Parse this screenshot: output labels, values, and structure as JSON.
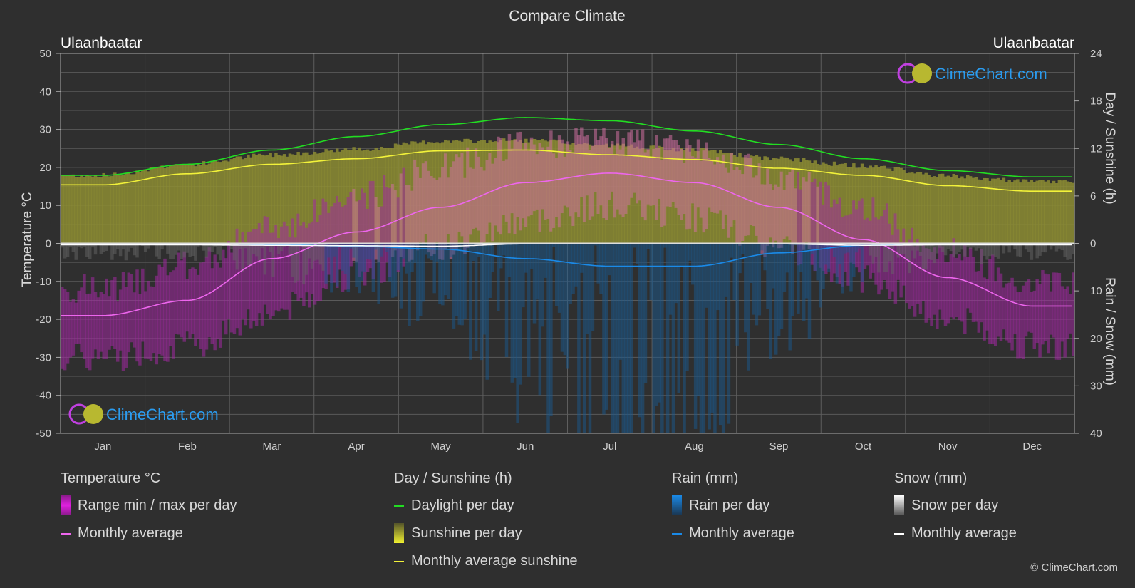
{
  "page_title": "Compare Climate",
  "location_left": "Ulaanbaatar",
  "location_right": "Ulaanbaatar",
  "watermark": "ClimeChart.com",
  "copyright": "© ClimeChart.com",
  "colors": {
    "background": "#2f2f2f",
    "daylight": "#22dd22",
    "sunshine_avg": "#f2f23a",
    "sunshine_fill": "#8c8c32",
    "temp_avg": "#ee66ee",
    "temp_range": "#b030b0",
    "rain": "#1a8ae8",
    "snow": "#ffffff",
    "watermark": "#2a9cf0"
  },
  "legend": {
    "groups": [
      {
        "title": "Temperature °C",
        "items": [
          {
            "label": "Range min / max per day",
            "kind": "bar",
            "color": "#e020e0"
          },
          {
            "label": "Monthly average",
            "kind": "line",
            "color": "#ee66ee"
          }
        ]
      },
      {
        "title": "Day / Sunshine (h)",
        "items": [
          {
            "label": "Daylight per day",
            "kind": "line",
            "color": "#22dd22"
          },
          {
            "label": "Sunshine per day",
            "kind": "bar",
            "color": "#e8e830"
          },
          {
            "label": "Monthly average sunshine",
            "kind": "line",
            "color": "#f2f23a"
          }
        ]
      },
      {
        "title": "Rain (mm)",
        "items": [
          {
            "label": "Rain per day",
            "kind": "bar",
            "color": "#1a8ae8"
          },
          {
            "label": "Monthly average",
            "kind": "line",
            "color": "#1a8ae8"
          }
        ]
      },
      {
        "title": "Snow (mm)",
        "items": [
          {
            "label": "Snow per day",
            "kind": "bar",
            "color": "#ffffff"
          },
          {
            "label": "Monthly average",
            "kind": "line",
            "color": "#ffffff"
          }
        ]
      }
    ]
  },
  "chart_data": {
    "type": "line",
    "title": "Compare Climate",
    "categories": [
      "Jan",
      "Feb",
      "Mar",
      "Apr",
      "May",
      "Jun",
      "Jul",
      "Aug",
      "Sep",
      "Oct",
      "Nov",
      "Dec"
    ],
    "y_left": {
      "label": "Temperature °C",
      "range": [
        -50,
        50
      ],
      "ticks": [
        50,
        40,
        30,
        20,
        10,
        0,
        -10,
        -20,
        -30,
        -40,
        -50
      ]
    },
    "y_right_top": {
      "label": "Day / Sunshine (h)",
      "range": [
        0,
        24
      ],
      "ticks": [
        24,
        18,
        12,
        6,
        0
      ]
    },
    "y_right_bottom": {
      "label": "Rain / Snow (mm)",
      "range": [
        0,
        40
      ],
      "ticks": [
        0,
        10,
        20,
        30,
        40
      ]
    },
    "grid": true,
    "series": [
      {
        "name": "Daylight per day (h)",
        "axis": "sunshine",
        "values": [
          8.6,
          10.0,
          11.8,
          13.5,
          15.0,
          15.9,
          15.5,
          14.2,
          12.5,
          10.7,
          9.2,
          8.4
        ]
      },
      {
        "name": "Monthly average sunshine (h)",
        "axis": "sunshine",
        "values": [
          7.4,
          8.8,
          10.0,
          10.7,
          11.7,
          11.8,
          11.2,
          10.6,
          9.5,
          8.6,
          7.3,
          6.6
        ]
      },
      {
        "name": "Monthly average temperature (°C)",
        "axis": "temperature",
        "values": [
          -19.0,
          -15.0,
          -4.0,
          3.0,
          9.5,
          16.0,
          18.5,
          16.0,
          9.5,
          1.0,
          -9.0,
          -16.5
        ]
      },
      {
        "name": "Rain monthly average (mm)",
        "axis": "precip",
        "values": [
          0.0,
          0.0,
          0.2,
          0.6,
          1.2,
          3.2,
          4.8,
          4.8,
          2.0,
          0.4,
          0.1,
          0.0
        ]
      },
      {
        "name": "Snow monthly average (mm)",
        "axis": "precip",
        "values": [
          0.3,
          0.3,
          0.4,
          0.5,
          0.6,
          0.1,
          0.0,
          0.0,
          0.1,
          0.4,
          0.3,
          0.3
        ]
      },
      {
        "name": "Temperature daily max envelope (°C)",
        "axis": "temperature",
        "values": [
          -12,
          -6,
          4,
          12,
          20,
          26,
          27,
          25,
          18,
          9,
          -2,
          -10
        ]
      },
      {
        "name": "Temperature daily min envelope (°C)",
        "axis": "temperature",
        "values": [
          -30,
          -27,
          -18,
          -8,
          -1,
          6,
          10,
          7,
          -1,
          -9,
          -20,
          -27
        ]
      }
    ]
  }
}
